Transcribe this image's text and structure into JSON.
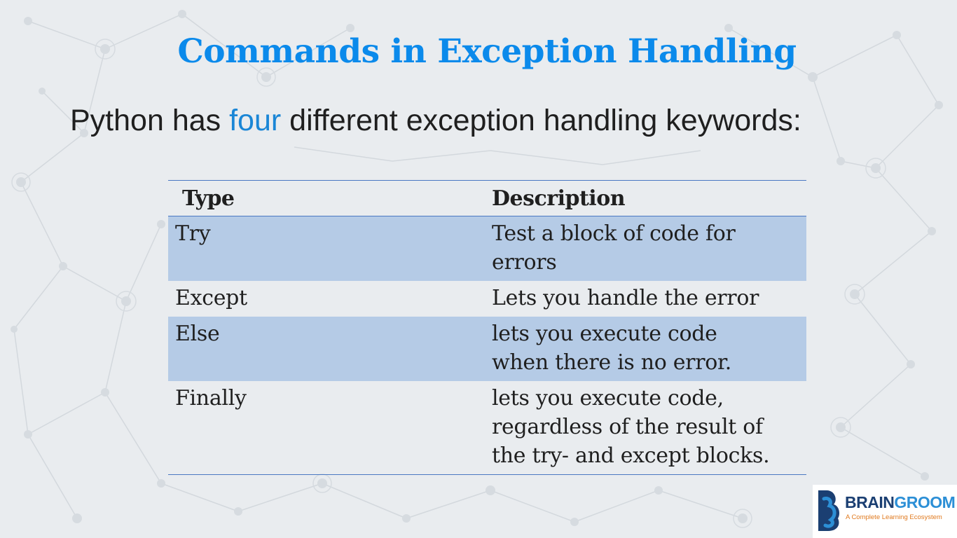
{
  "slide": {
    "title": "Commands in Exception Handling",
    "intro": {
      "before": "Python has ",
      "highlight": "four",
      "after": " different exception handling keywords:"
    }
  },
  "table": {
    "headers": [
      "Type",
      "Description"
    ],
    "rows": [
      {
        "type": "Try",
        "description": "Test a block of code for errors",
        "lines": [
          "Test a block of code for",
          "errors"
        ]
      },
      {
        "type": "Except",
        "description": "Lets you handle the error",
        "lines": [
          "Lets you handle the error"
        ]
      },
      {
        "type": "Else",
        "description": "lets you execute code when there is no error.",
        "lines": [
          "lets you execute code",
          "when there is no error."
        ]
      },
      {
        "type": "Finally",
        "description": "lets you execute code, regardless of the result of the try- and except blocks.",
        "lines": [
          "lets you execute code,",
          "regardless of the result of",
          "the try- and except blocks."
        ]
      }
    ]
  },
  "logo": {
    "brand_left": "BRAIN",
    "brand_right": "GROOM",
    "tagline": "A Complete Learning Ecosystem"
  },
  "colors": {
    "title": "#0b8aeb",
    "highlight": "#1a86d6",
    "table_rule": "#4a78c2",
    "row_shade": "#b6c9e4",
    "brand_navy": "#1b3f72",
    "brand_blue": "#2c8fd6",
    "tagline": "#e07a1f"
  }
}
